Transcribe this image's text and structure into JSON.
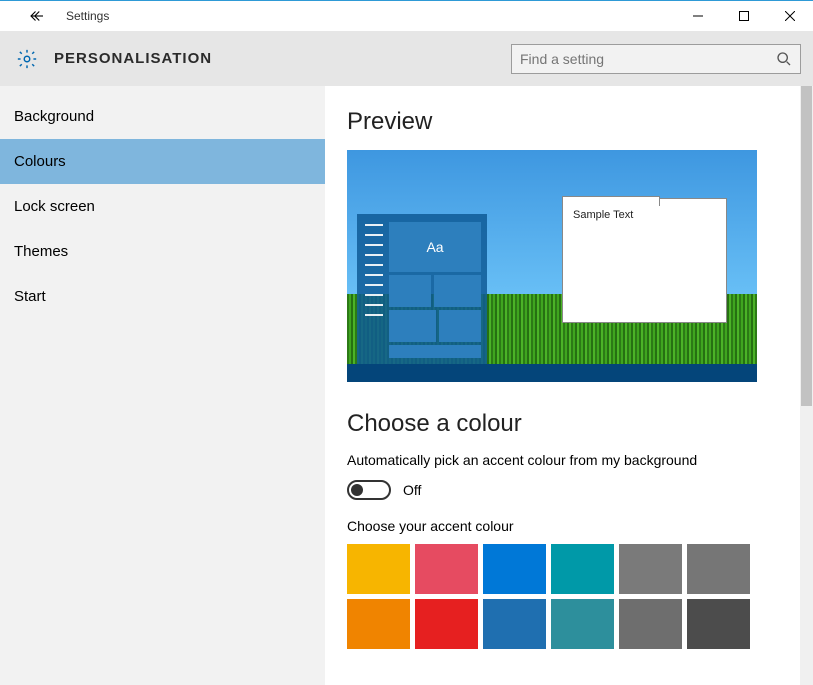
{
  "window": {
    "title": "Settings"
  },
  "header": {
    "section": "PERSONALISATION",
    "search_placeholder": "Find a setting"
  },
  "sidebar": {
    "items": [
      {
        "label": "Background",
        "active": false
      },
      {
        "label": "Colours",
        "active": true
      },
      {
        "label": "Lock screen",
        "active": false
      },
      {
        "label": "Themes",
        "active": false
      },
      {
        "label": "Start",
        "active": false
      }
    ]
  },
  "content": {
    "preview_heading": "Preview",
    "preview_sample_text": "Sample Text",
    "preview_aa": "Aa",
    "choose_heading": "Choose a colour",
    "auto_label": "Automatically pick an accent colour from my background",
    "auto_state": "Off",
    "accent_label": "Choose your accent colour",
    "swatches_row1": [
      "#F7B500",
      "#E64B61",
      "#0078D7",
      "#0099A8",
      "#7A7A7A",
      "#767676"
    ],
    "swatches_row2": [
      "#F08400",
      "#E62020",
      "#1F6FB0",
      "#2D8F9C",
      "#6E6E6E",
      "#4C4C4C"
    ]
  }
}
